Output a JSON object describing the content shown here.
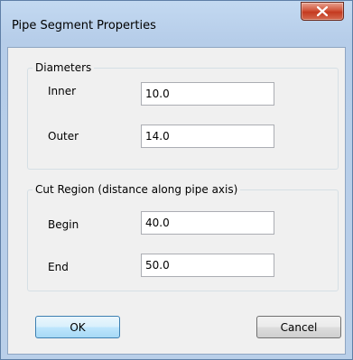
{
  "window": {
    "title": "Pipe Segment Properties",
    "close_icon": "close-icon"
  },
  "diameters": {
    "legend": "Diameters",
    "inner_label": "Inner",
    "inner_value": "10.0",
    "outer_label": "Outer",
    "outer_value": "14.0"
  },
  "cut_region": {
    "legend": "Cut Region (distance along pipe axis)",
    "begin_label": "Begin",
    "begin_value": "40.0",
    "end_label": "End",
    "end_value": "50.0"
  },
  "buttons": {
    "ok": "OK",
    "cancel": "Cancel"
  }
}
